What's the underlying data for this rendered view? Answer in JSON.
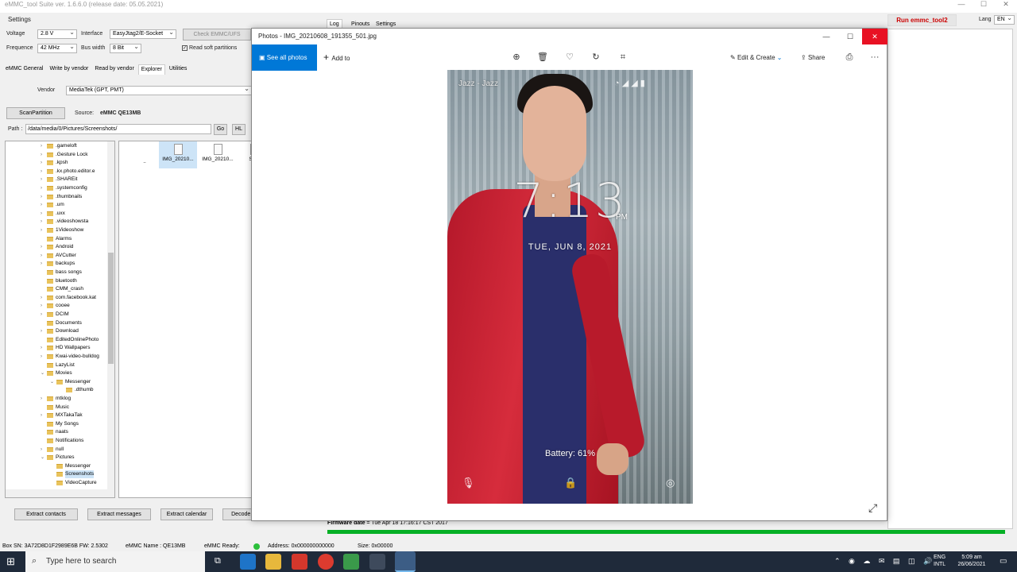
{
  "app": {
    "title": "eMMC_tool Suite  ver. 1.6.6.0 (release date: 05.05.2021)",
    "window_controls": [
      "—",
      "☐",
      "✕"
    ]
  },
  "settings": {
    "group_label": "Settings",
    "voltage_label": "Voltage",
    "voltage_value": "2.8 V",
    "interface_label": "Interface",
    "interface_value": "EasyJtag2/E-Socket",
    "check_button": "Check EMMC/UFS",
    "frequence_label": "Frequence",
    "frequence_value": "42 MHz",
    "buswidth_label": "Bus width",
    "buswidth_value": "8 Bit",
    "read_soft_partitions": "Read soft partitions"
  },
  "top_tabs": [
    "Log",
    "Pinouts",
    "Settings"
  ],
  "run_button": "Run emmc_tool2",
  "lang_label": "Lang",
  "lang_value": "EN",
  "main_tabs": [
    "eMMC General",
    "Write by vendor",
    "Read by vendor",
    "Explorer",
    "Utilities"
  ],
  "explorer": {
    "vendor_label": "Vendor",
    "vendor_value": "MediaTek (GPT, PMT)",
    "scan_button": "ScanPartition",
    "source_label": "Source:",
    "source_value": "eMMC QE13MB",
    "path_label": "Path :",
    "path_value": "/data/media/0/Pictures/Screenshots/",
    "go_button": "Go",
    "hl_button": "HL"
  },
  "tree_items": [
    {
      "name": ".gameloft",
      "exp": "›",
      "indent": 0
    },
    {
      "name": ".Gesture Lock",
      "exp": "›",
      "indent": 0
    },
    {
      "name": ".kpsh",
      "exp": "›",
      "indent": 0
    },
    {
      "name": ".kx.photo.editor.e",
      "exp": "›",
      "indent": 0
    },
    {
      "name": ".SHAREit",
      "exp": "›",
      "indent": 0
    },
    {
      "name": ".systemconfig",
      "exp": "›",
      "indent": 0
    },
    {
      "name": ".thumbnails",
      "exp": "›",
      "indent": 0
    },
    {
      "name": ".um",
      "exp": "›",
      "indent": 0
    },
    {
      "name": ".uxx",
      "exp": "›",
      "indent": 0
    },
    {
      "name": ".videoshowsta",
      "exp": "›",
      "indent": 0
    },
    {
      "name": "1Videoshow",
      "exp": "›",
      "indent": 0
    },
    {
      "name": "Alarms",
      "exp": "",
      "indent": 0
    },
    {
      "name": "Android",
      "exp": "›",
      "indent": 0
    },
    {
      "name": "AVCutter",
      "exp": "›",
      "indent": 0
    },
    {
      "name": "backups",
      "exp": "›",
      "indent": 0
    },
    {
      "name": "bass songs",
      "exp": "",
      "indent": 0
    },
    {
      "name": "bluetooth",
      "exp": "",
      "indent": 0
    },
    {
      "name": "CMM_crash",
      "exp": "",
      "indent": 0
    },
    {
      "name": "com.facebook.kat",
      "exp": "›",
      "indent": 0
    },
    {
      "name": "cooee",
      "exp": "›",
      "indent": 0
    },
    {
      "name": "DCIM",
      "exp": "›",
      "indent": 0
    },
    {
      "name": "Documents",
      "exp": "",
      "indent": 0
    },
    {
      "name": "Download",
      "exp": "›",
      "indent": 0
    },
    {
      "name": "EditedOnlinePhoto",
      "exp": "",
      "indent": 0
    },
    {
      "name": "HD Wallpapers",
      "exp": "›",
      "indent": 0
    },
    {
      "name": "Kwai-video-bulldog",
      "exp": "›",
      "indent": 0
    },
    {
      "name": "LazyList",
      "exp": "",
      "indent": 0
    },
    {
      "name": "Movies",
      "exp": "⌄",
      "indent": 0
    },
    {
      "name": "Messenger",
      "exp": "⌄",
      "indent": 1
    },
    {
      "name": ".dthumb",
      "exp": "",
      "indent": 2
    },
    {
      "name": "mtklog",
      "exp": "›",
      "indent": 0
    },
    {
      "name": "Music",
      "exp": "",
      "indent": 0
    },
    {
      "name": "MXTakaTak",
      "exp": "›",
      "indent": 0
    },
    {
      "name": "My Songs",
      "exp": "",
      "indent": 0
    },
    {
      "name": "naats",
      "exp": "",
      "indent": 0
    },
    {
      "name": "Notifications",
      "exp": "",
      "indent": 0
    },
    {
      "name": "null",
      "exp": "›",
      "indent": 0
    },
    {
      "name": "Pictures",
      "exp": "⌄",
      "indent": 0
    },
    {
      "name": "Messenger",
      "exp": "",
      "indent": 1
    },
    {
      "name": "Screenshots",
      "exp": "",
      "indent": 1,
      "selected": true
    },
    {
      "name": "VideoCapture",
      "exp": "",
      "indent": 1
    }
  ],
  "files": [
    {
      "name": "..",
      "icon": false
    },
    {
      "name": "IMG_20210...",
      "icon": true,
      "selected": true
    },
    {
      "name": "IMG_20210...",
      "icon": true
    },
    {
      "name": "Scre",
      "icon": true
    }
  ],
  "bottom_buttons": [
    "Extract contacts",
    "Extract messages",
    "Extract calendar",
    "Decode PIN"
  ],
  "photos": {
    "title": "Photos - IMG_20210608_191355_501.jpg",
    "see_all": "See all photos",
    "add_to": "Add to",
    "edit_create": "Edit & Create",
    "share": "Share",
    "more": "···",
    "expand_icon": "⤢"
  },
  "phone": {
    "carrier": "Jazz - Jazz",
    "time": "7:13",
    "ampm": "PM",
    "date": "TUE, JUN 8, 2021",
    "battery": "Battery: 61%"
  },
  "log": {
    "firmware_label": "Firmware date",
    "firmware_value": "= Tue Apr 18 17:16:17 CST 2017"
  },
  "status": {
    "box_sn": "Box SN:  3A72D8D1F2989E6B   FW:  2.5302",
    "emmc_name": "eMMC Name : QE13MB",
    "emmc_ready": "eMMC Ready:",
    "address": "Address: 0x000000000000",
    "size": "Size: 0x00000"
  },
  "taskbar": {
    "search_placeholder": "Type here to search",
    "lang1": "ENG",
    "lang2": "INTL",
    "time": "5:09 am",
    "date": "26/06/2021"
  },
  "colors": {
    "accent": "#0078d7",
    "close": "#e81123",
    "progress": "#06b025",
    "run_button_text": "#cc0000"
  }
}
